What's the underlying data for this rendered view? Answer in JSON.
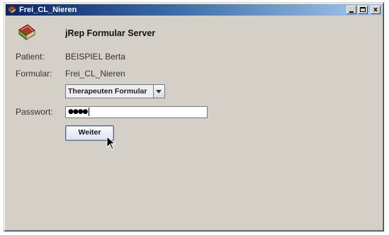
{
  "window": {
    "title": "Frei_CL_Nieren",
    "controls": {
      "minimize": "minimize",
      "maximize": "maximize",
      "close": "x"
    }
  },
  "header": {
    "icon": "book-logo-icon",
    "title": "jRep Formular Server"
  },
  "form": {
    "patient_label": "Patient:",
    "patient_value": "BEISPIEL Berta",
    "formular_label": "Formular:",
    "formular_value": "Frei_CL_Nieren",
    "select_value": "Therapeuten Formular",
    "password_label": "Passwort:",
    "password_mask": "●●●●",
    "submit_label": "Weiter"
  },
  "icons": {
    "app": "app-book-icon",
    "dropdown": "chevron-down-icon",
    "cursor": "mouse-pointer-icon"
  }
}
